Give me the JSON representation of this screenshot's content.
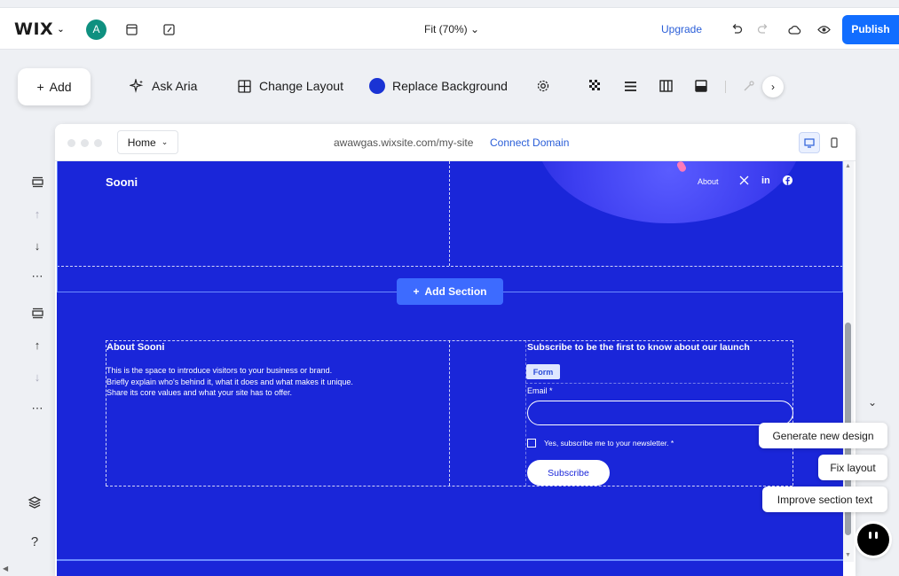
{
  "topbar": {
    "logo": "WIX",
    "avatar_letter": "A",
    "zoom": "Fit (70%)",
    "upgrade": "Upgrade",
    "publish": "Publish"
  },
  "toolbar": {
    "add": "Add",
    "ask_aria": "Ask Aria",
    "change_layout": "Change Layout",
    "replace_background": "Replace Background",
    "background_color": "#1a33d4"
  },
  "browser": {
    "page": "Home",
    "url": "awawgas.wixsite.com/my-site",
    "connect_domain": "Connect Domain"
  },
  "site": {
    "background_color": "#1a26d9",
    "header": {
      "title": "Sooni",
      "nav_about": "About",
      "social": [
        "x-icon",
        "linkedin-icon",
        "facebook-icon"
      ]
    },
    "add_section": "Add Section",
    "about": {
      "heading": "About Sooni",
      "lines": [
        "This is the space to introduce visitors to your business or brand.",
        "Briefly explain who's behind it, what it does and what makes it unique.",
        "Share its core values and what your site has to offer."
      ]
    },
    "subscribe": {
      "heading": "Subscribe to be the first to know about our launch",
      "form_tag": "Form",
      "email_label": "Email *",
      "checkbox_label": "Yes, subscribe me to your newsletter. *",
      "button": "Subscribe"
    }
  },
  "aria": {
    "suggestions": [
      "Generate new design",
      "Fix layout",
      "Improve section text"
    ]
  }
}
